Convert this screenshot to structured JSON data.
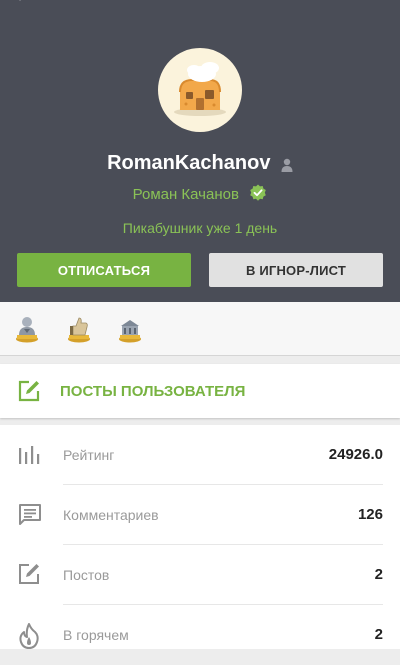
{
  "profile": {
    "username": "RomanKachanov",
    "real_name": "Роман Качанов",
    "since": "Пикабушник уже 1 день"
  },
  "actions": {
    "unsubscribe_label": "ОТПИСАТЬСЯ",
    "ignore_label": "В ИГНОР-ЛИСТ"
  },
  "awards": [
    "award-bust-icon",
    "award-thumbs-up-icon",
    "award-building-icon"
  ],
  "posts_link": {
    "label": "ПОСТЫ ПОЛЬЗОВАТЕЛЯ",
    "icon": "edit-icon"
  },
  "stats": [
    {
      "label": "Рейтинг",
      "value": "24926.0",
      "icon": "bar-chart-icon"
    },
    {
      "label": "Комментариев",
      "value": "126",
      "icon": "comment-icon"
    },
    {
      "label": "Постов",
      "value": "2",
      "icon": "edit-icon"
    },
    {
      "label": "В горячем",
      "value": "2",
      "icon": "flame-icon"
    }
  ],
  "colors": {
    "header_bg": "#4a4d57",
    "accent": "#78b342",
    "accent_text": "#8ac256"
  }
}
